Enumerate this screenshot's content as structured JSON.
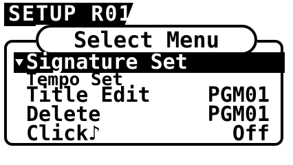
{
  "screen": {
    "title": "SETUP R01",
    "menu_title": "Select Menu",
    "items": [
      {
        "label": "Signature Set",
        "value": ""
      },
      {
        "label": "Tempo Set",
        "value": ""
      },
      {
        "label": "Title Edit",
        "value": "PGM01"
      },
      {
        "label": "Delete",
        "value": "PGM01"
      },
      {
        "label": "Click♪",
        "value": "Off"
      }
    ],
    "selected_index": 0,
    "colors": {
      "foreground": "#000000",
      "background": "#ffffff"
    },
    "icons": {
      "cursor": "triangle-down-icon"
    }
  }
}
